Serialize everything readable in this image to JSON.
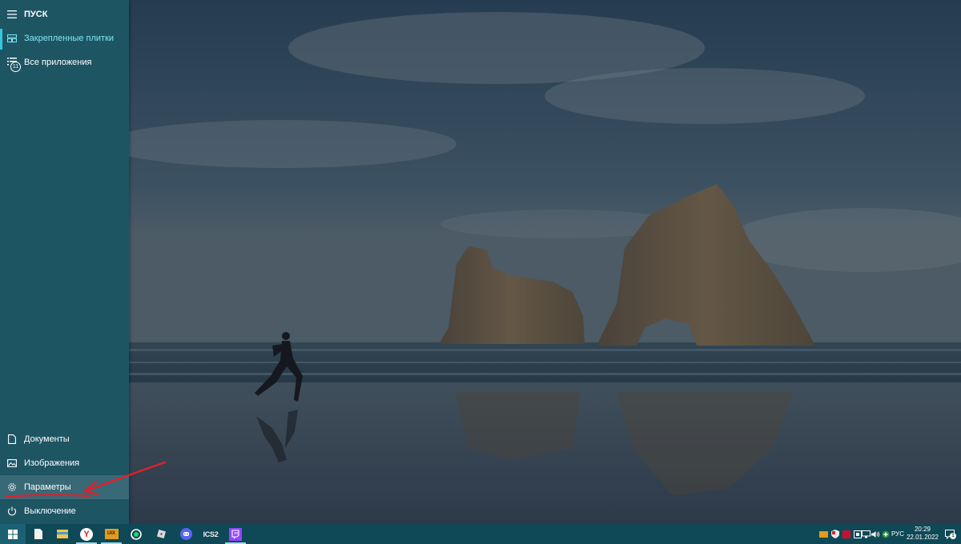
{
  "start_menu": {
    "title": "ПУСК",
    "pinned_tiles": "Закрепленные плитки",
    "all_apps": "Все приложения",
    "all_apps_badge": "11",
    "documents": "Документы",
    "images": "Изображения",
    "settings": "Параметры",
    "power": "Выключение"
  },
  "taskbar": {
    "apps": [
      {
        "name": "windows-start",
        "icon": "windows-logo-icon"
      },
      {
        "name": "file-explorer-doc",
        "icon": "file-icon"
      },
      {
        "name": "file-explorer",
        "icon": "folder-icon"
      },
      {
        "name": "yandex-browser",
        "icon": "yandex-icon",
        "label": "Y"
      },
      {
        "name": "uix",
        "icon": "uix-icon",
        "label": "UIX"
      },
      {
        "name": "whatsapp",
        "icon": "whatsapp-icon"
      },
      {
        "name": "roblox",
        "icon": "roblox-icon"
      },
      {
        "name": "discord",
        "icon": "discord-icon"
      },
      {
        "name": "csgo",
        "icon": "csgo-icon",
        "label": "ICS2"
      },
      {
        "name": "twitch",
        "icon": "twitch-icon"
      }
    ],
    "tray": {
      "language": "РУС",
      "time": "20:29",
      "date": "22.01.2022",
      "notification_badge": "1"
    }
  },
  "colors": {
    "start_menu_bg": "#1e5563",
    "accent": "#35c7e0",
    "taskbar_bg": "#0f4856",
    "annotation": "#e0202a"
  }
}
